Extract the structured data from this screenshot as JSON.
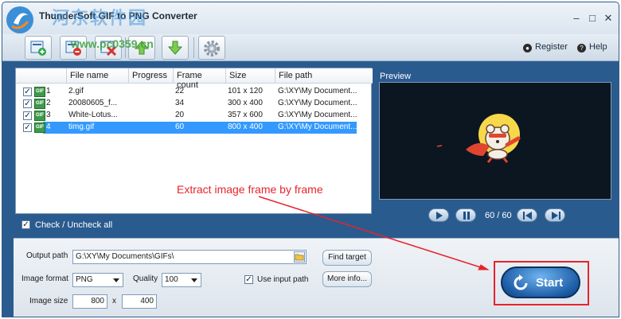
{
  "app": {
    "title": "ThunderSoft GIF to PNG Converter",
    "watermark": "河东软件园",
    "watermark_url": "www.pc0359.cn",
    "window_controls": [
      "–",
      "□",
      "✕"
    ]
  },
  "toolbar": {
    "buttons": [
      "add-files",
      "remove-file",
      "clear-list",
      "move-up",
      "move-down",
      "settings"
    ]
  },
  "top_links": {
    "register": "Register",
    "help": "Help"
  },
  "file_list": {
    "columns": [
      "File name",
      "Progress",
      "Frame count",
      "Size",
      "File path"
    ],
    "rows": [
      {
        "num": "1",
        "name": "2.gif",
        "progress": "",
        "frames": "22",
        "size": "101 x 120",
        "path": "G:\\XY\\My Document...",
        "checked": true,
        "selected": false
      },
      {
        "num": "2",
        "name": "20080605_f...",
        "progress": "",
        "frames": "34",
        "size": "300 x 400",
        "path": "G:\\XY\\My Document...",
        "checked": true,
        "selected": false
      },
      {
        "num": "3",
        "name": "White-Lotus...",
        "progress": "",
        "frames": "20",
        "size": "357 x 600",
        "path": "G:\\XY\\My Document...",
        "checked": true,
        "selected": false
      },
      {
        "num": "4",
        "name": "timg.gif",
        "progress": "",
        "frames": "60",
        "size": "800 x 400",
        "path": "G:\\XY\\My Document...",
        "checked": true,
        "selected": true
      }
    ],
    "icon_text": "GIF"
  },
  "check_all": {
    "label": "Check / Uncheck all",
    "checked": true
  },
  "preview": {
    "label": "Preview",
    "frame_counter": "60 / 60",
    "controls": [
      "play",
      "pause",
      "first-frame",
      "last-frame"
    ]
  },
  "annotation": {
    "text": "Extract image frame by frame",
    "color": "#e8232b"
  },
  "output": {
    "path_label": "Output path",
    "path_value": "G:\\XY\\My Documents\\GIFs\\",
    "find_target": "Find target",
    "format_label": "Image format",
    "format_value": "PNG",
    "quality_label": "Quality",
    "quality_value": "100",
    "use_input_path": "Use input path",
    "use_input_checked": true,
    "more_info": "More info...",
    "size_label": "Image size",
    "width": "800",
    "x": "x",
    "height": "400"
  },
  "start": {
    "label": "Start"
  },
  "colors": {
    "background": "#2a5b8f",
    "accent": "#3399ff",
    "highlight": "#e8232b"
  }
}
